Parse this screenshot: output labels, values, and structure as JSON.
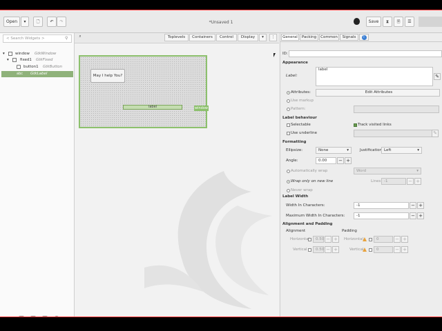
{
  "header": {
    "open_label": "Open",
    "window_title": "*Unsaved 1",
    "save_label": "Save"
  },
  "left": {
    "search_placeholder": "< Search Widgets >",
    "tree": [
      {
        "name": "window",
        "class": "GtkWindow"
      },
      {
        "name": "fixed1",
        "class": "GtkFixed"
      },
      {
        "name": "button1",
        "class": "GtkButton"
      },
      {
        "name": "",
        "class": "GtkLabel"
      }
    ]
  },
  "center": {
    "toolbar": [
      "Toplevels",
      "Containers",
      "Control",
      "Display"
    ],
    "canvas": {
      "button_text": "May I help You?",
      "label_text": "label",
      "window_tag": "window"
    }
  },
  "right": {
    "tabs": [
      "General",
      "Packing",
      "Common",
      "Signals"
    ],
    "id_label": "ID:",
    "id_value": "",
    "appearance": {
      "header": "Appearance",
      "label_label": "Label:",
      "label_value": "label",
      "attributes_radio": "Attributes:",
      "edit_attributes_btn": "Edit Attributes",
      "use_markup": "Use markup",
      "pattern": "Pattern:"
    },
    "behaviour": {
      "header": "Label behaviour",
      "selectable": "Selectable",
      "track_visited": "Track visited links",
      "use_underline": "Use underline"
    },
    "formatting": {
      "header": "Formatting",
      "ellipsize_label": "Ellipsize:",
      "ellipsize_value": "None",
      "justification_label": "Justification:",
      "justification_value": "Left",
      "angle_label": "Angle:",
      "angle_value": "0.00",
      "auto_wrap": "Automatically wrap",
      "wrap_mode_value": "Word",
      "wrap_newline": "Wrap only on new line",
      "lines_label": "Lines:",
      "lines_value": "-1",
      "never_wrap": "Never wrap"
    },
    "label_width": {
      "header": "Label Width",
      "width_chars_label": "Width In Characters:",
      "width_chars_value": "-1",
      "max_width_label": "Maximum Width In Characters:",
      "max_width_value": "-1"
    },
    "align": {
      "header": "Alignment and Padding",
      "alignment_label": "Alignment",
      "padding_label": "Padding",
      "horizontal_label": "Horizontal",
      "vertical_label": "Vertical",
      "h_align_value": "0.50",
      "v_align_value": "0.50",
      "h_pad_value": "0",
      "v_pad_value": "0"
    }
  },
  "colors": {
    "selection": "#8fb27a",
    "design_border": "#8cc06c",
    "warning": "#e8a33d"
  }
}
